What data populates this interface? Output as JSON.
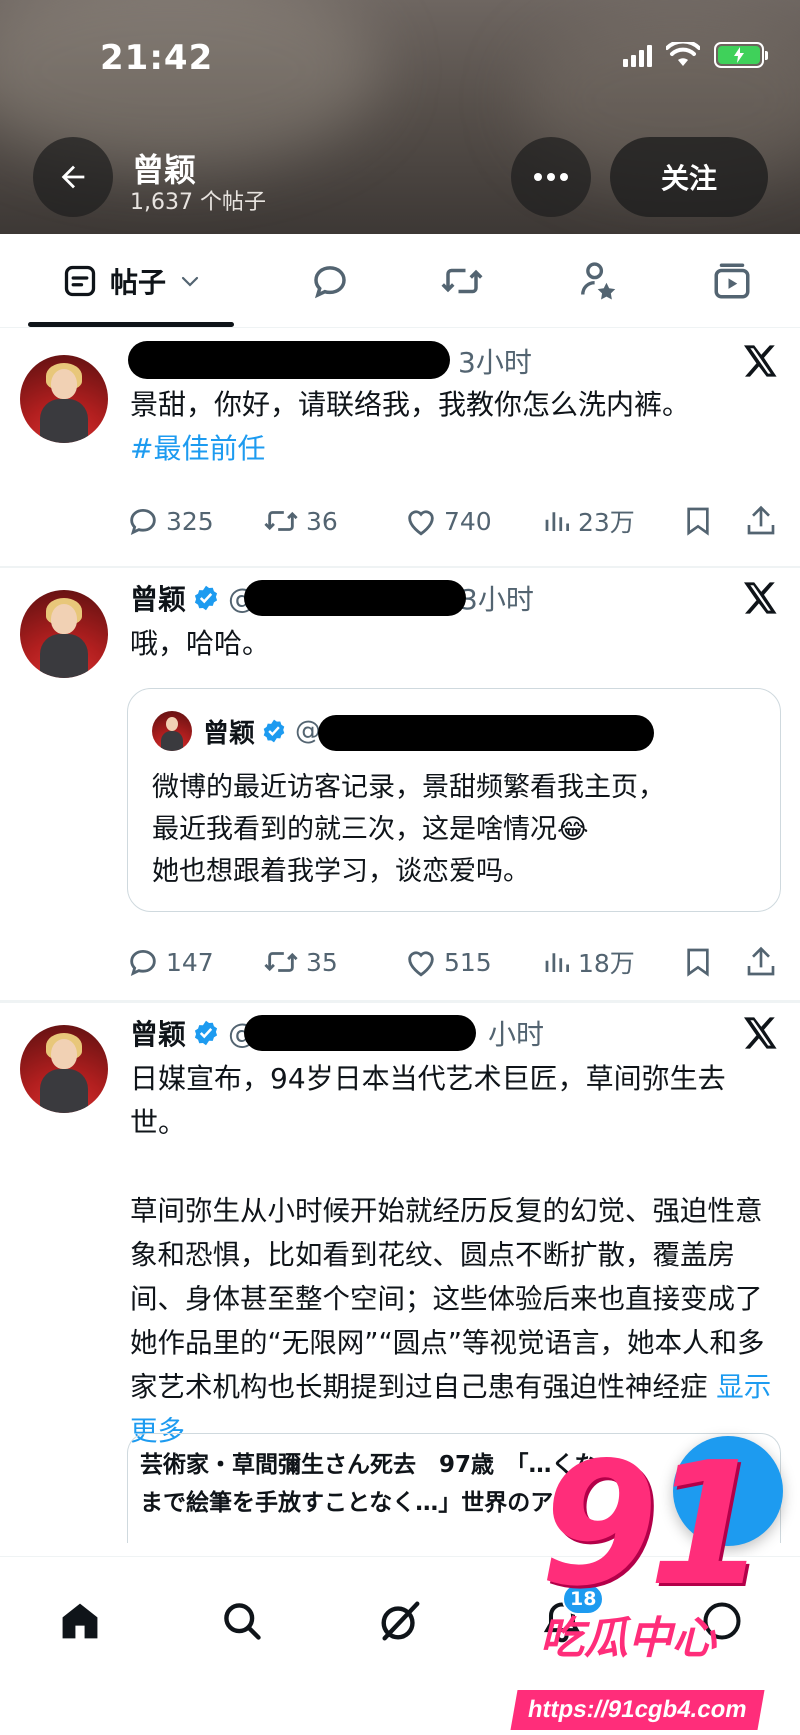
{
  "status_bar": {
    "time": "21:42",
    "signal": "signal-icon",
    "wifi": "wifi-icon",
    "battery": "battery-charging-icon"
  },
  "header": {
    "name": "曾颖",
    "post_count": "1,637 个帖子",
    "follow_label": "关注"
  },
  "tabs": {
    "posts_label": "帖子"
  },
  "tweets": [
    {
      "time": "3小时",
      "text": "景甜，你好，请联络我，我教你怎么洗内裤。",
      "hashtag": "#最佳前任",
      "replies": "325",
      "retweets": "36",
      "likes": "740",
      "views": "23万"
    },
    {
      "name": "曾颖",
      "handle_prefix": "@",
      "time": "3小时",
      "text": "哦，哈哈。",
      "quote": {
        "name": "曾颖",
        "handle_prefix": "@",
        "text_line1": "微博的最近访客记录，景甜频繁看我主页，",
        "text_line2": "最近我看到的就三次，这是啥情况😂",
        "text_line3": "她也想跟着我学习，谈恋爱吗。"
      },
      "replies": "147",
      "retweets": "35",
      "likes": "515",
      "views": "18万"
    },
    {
      "name": "曾颖",
      "handle_prefix": "@",
      "time": "小时",
      "text_p1": "日媒宣布，94岁日本当代艺术巨匠，草间弥生去世。",
      "text_p2": "草间弥生从小时候开始就经历反复的幻觉、强迫性意象和恐惧，比如看到花纹、圆点不断扩散，覆盖房间、身体甚至整个空间；这些体验后来也直接变成了她作品里的“无限网”“圆点”等视觉语言，她本人和多家艺术机构也长期提到过自己患有强迫性神经症",
      "show_more": "显示更多",
      "link_card": {
        "line1": "芸術家・草間彌生さん死去　97歳　「…くな…",
        "line2": "まで絵筆を手放すことなく…」世界のア…"
      }
    }
  ],
  "bottom_nav": {
    "notification_count": "18",
    "items": [
      "home-icon",
      "search-icon",
      "grok-icon",
      "notifications-icon",
      "messages-icon"
    ]
  },
  "watermark": {
    "number": "91",
    "brand": "吃瓜中心",
    "url": "https://91cgb4.com"
  }
}
